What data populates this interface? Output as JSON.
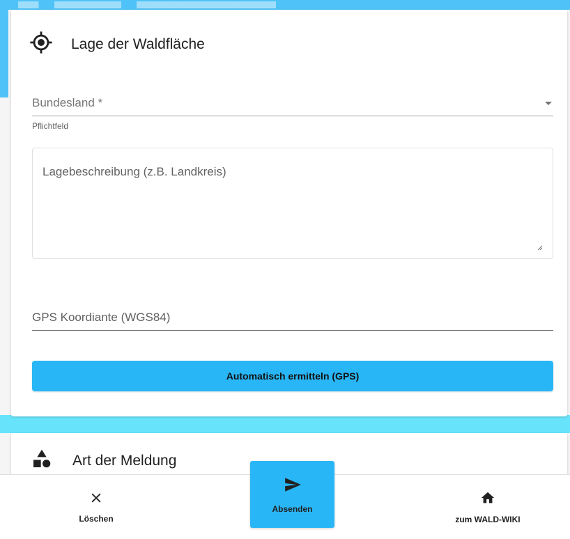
{
  "colors": {
    "accent": "#29b6f6",
    "band": "#4fc3f7",
    "strip": "#67e4fb"
  },
  "location_card": {
    "icon": "gps-fixed-icon",
    "title": "Lage der Waldfläche",
    "state_select": {
      "label": "Bundesland *",
      "hint": "Pflichtfeld"
    },
    "description": {
      "placeholder": "Lagebeschreibung (z.B. Landkreis)"
    },
    "gps": {
      "placeholder": "GPS Koordiante (WGS84)",
      "button_label": "Automatisch ermitteln (GPS)"
    }
  },
  "report_card": {
    "icon": "category-shapes-icon",
    "title": "Art der Meldung"
  },
  "bottom_nav": {
    "delete": {
      "icon": "close-icon",
      "label": "Löschen"
    },
    "submit": {
      "icon": "send-icon",
      "label": "Absenden"
    },
    "wiki": {
      "icon": "home-icon",
      "label": "zum WALD-WIKI"
    }
  }
}
